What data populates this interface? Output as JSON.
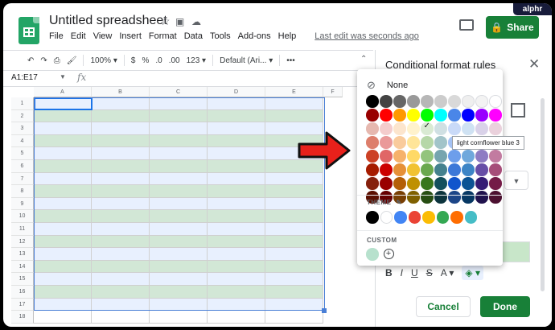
{
  "app": {
    "title": "Untitled spreadsheet",
    "menu": [
      "File",
      "Edit",
      "View",
      "Insert",
      "Format",
      "Data",
      "Tools",
      "Add-ons",
      "Help"
    ],
    "last_edit": "Last edit was seconds ago",
    "share_label": "Share",
    "watermark": "alphr"
  },
  "toolbar": {
    "zoom": "100%",
    "currency": "$",
    "percent": "%",
    "dec_less": ".0",
    "dec_more": ".00",
    "num_format": "123",
    "font": "Default (Ari...",
    "more": "•••"
  },
  "formula_bar": {
    "name_box": "A1:E17",
    "fx": "fx"
  },
  "sheet": {
    "columns": [
      "A",
      "B",
      "C",
      "D",
      "E",
      "F"
    ],
    "rows": [
      "1",
      "2",
      "3",
      "4",
      "5",
      "6",
      "7",
      "8",
      "9",
      "10",
      "11",
      "12",
      "13",
      "14",
      "15",
      "16",
      "17",
      "18"
    ],
    "band_color_1": "#e8f0fe",
    "band_color_2": "#d2e7d6"
  },
  "panel": {
    "title": "Conditional format rules",
    "format_icons": [
      "B",
      "I",
      "U",
      "S",
      "A"
    ],
    "cancel_label": "Cancel",
    "done_label": "Done"
  },
  "palette": {
    "none_label": "None",
    "theme_label": "THEME",
    "custom_label": "CUSTOM",
    "tooltip": "light cornflower blue 3",
    "rows": [
      [
        "#000000",
        "#434343",
        "#666666",
        "#999999",
        "#b7b7b7",
        "#cccccc",
        "#d9d9d9",
        "#efefef",
        "#f3f3f3",
        "#ffffff"
      ],
      [
        "#980000",
        "#ff0000",
        "#ff9900",
        "#ffff00",
        "#00ff00",
        "#00ffff",
        "#4a86e8",
        "#0000ff",
        "#9900ff",
        "#ff00ff"
      ],
      [
        "#e6b8af",
        "#f4cccc",
        "#fce5cd",
        "#fff2cc",
        "#d9ead3",
        "#d0e0e3",
        "#c9daf8",
        "#cfe2f3",
        "#d9d2e9",
        "#ead1dc"
      ],
      [
        "#dd7e6b",
        "#ea9999",
        "#f9cb9c",
        "#ffe599",
        "#b6d7a8",
        "#a2c4c9",
        "#a4c2f4",
        "#9fc5e8",
        "#b4a7d6",
        "#d5a6bd"
      ],
      [
        "#cc4125",
        "#e06666",
        "#f6b26b",
        "#ffd966",
        "#93c47d",
        "#76a5af",
        "#6d9eeb",
        "#6fa8dc",
        "#8e7cc3",
        "#c27ba0"
      ],
      [
        "#a61c00",
        "#cc0000",
        "#e69138",
        "#f1c232",
        "#6aa84f",
        "#45818e",
        "#3c78d8",
        "#3d85c6",
        "#674ea7",
        "#a64d79"
      ],
      [
        "#85200c",
        "#990000",
        "#b45f06",
        "#bf9000",
        "#38761d",
        "#134f5c",
        "#1155cc",
        "#0b5394",
        "#351c75",
        "#741b47"
      ],
      [
        "#5b0f00",
        "#660000",
        "#783f04",
        "#7f6000",
        "#274e13",
        "#0c343d",
        "#1c4587",
        "#073763",
        "#20124d",
        "#4c1130"
      ]
    ],
    "theme_colors": [
      "#000000",
      "#ffffff",
      "#4285f4",
      "#ea4335",
      "#fbbc04",
      "#34a853",
      "#ff6d01",
      "#46bdc6"
    ],
    "custom_colors": [
      "#b7e1cd"
    ],
    "selected": [
      2,
      4
    ]
  }
}
